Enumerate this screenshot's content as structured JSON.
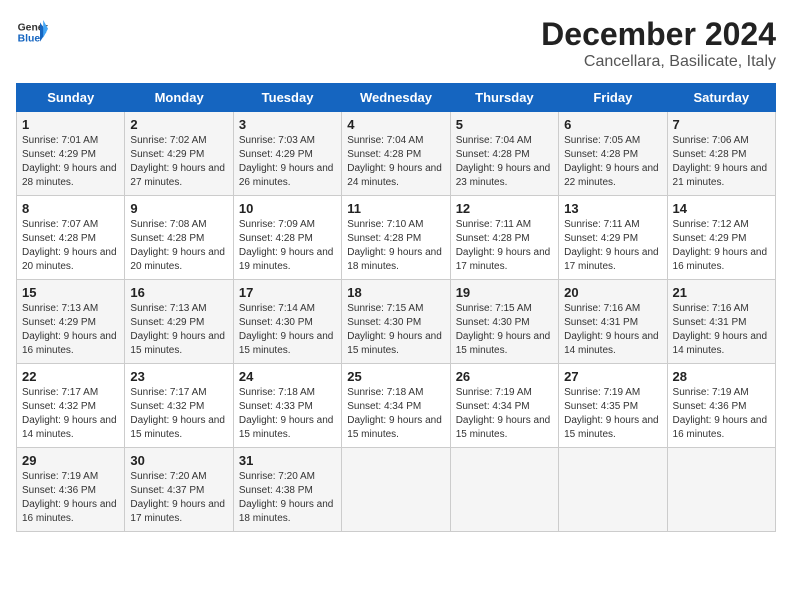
{
  "header": {
    "logo_line1": "General",
    "logo_line2": "Blue",
    "month": "December 2024",
    "location": "Cancellara, Basilicate, Italy"
  },
  "weekdays": [
    "Sunday",
    "Monday",
    "Tuesday",
    "Wednesday",
    "Thursday",
    "Friday",
    "Saturday"
  ],
  "weeks": [
    [
      {
        "day": "1",
        "sunrise": "Sunrise: 7:01 AM",
        "sunset": "Sunset: 4:29 PM",
        "daylight": "Daylight: 9 hours and 28 minutes."
      },
      {
        "day": "2",
        "sunrise": "Sunrise: 7:02 AM",
        "sunset": "Sunset: 4:29 PM",
        "daylight": "Daylight: 9 hours and 27 minutes."
      },
      {
        "day": "3",
        "sunrise": "Sunrise: 7:03 AM",
        "sunset": "Sunset: 4:29 PM",
        "daylight": "Daylight: 9 hours and 26 minutes."
      },
      {
        "day": "4",
        "sunrise": "Sunrise: 7:04 AM",
        "sunset": "Sunset: 4:28 PM",
        "daylight": "Daylight: 9 hours and 24 minutes."
      },
      {
        "day": "5",
        "sunrise": "Sunrise: 7:04 AM",
        "sunset": "Sunset: 4:28 PM",
        "daylight": "Daylight: 9 hours and 23 minutes."
      },
      {
        "day": "6",
        "sunrise": "Sunrise: 7:05 AM",
        "sunset": "Sunset: 4:28 PM",
        "daylight": "Daylight: 9 hours and 22 minutes."
      },
      {
        "day": "7",
        "sunrise": "Sunrise: 7:06 AM",
        "sunset": "Sunset: 4:28 PM",
        "daylight": "Daylight: 9 hours and 21 minutes."
      }
    ],
    [
      {
        "day": "8",
        "sunrise": "Sunrise: 7:07 AM",
        "sunset": "Sunset: 4:28 PM",
        "daylight": "Daylight: 9 hours and 20 minutes."
      },
      {
        "day": "9",
        "sunrise": "Sunrise: 7:08 AM",
        "sunset": "Sunset: 4:28 PM",
        "daylight": "Daylight: 9 hours and 20 minutes."
      },
      {
        "day": "10",
        "sunrise": "Sunrise: 7:09 AM",
        "sunset": "Sunset: 4:28 PM",
        "daylight": "Daylight: 9 hours and 19 minutes."
      },
      {
        "day": "11",
        "sunrise": "Sunrise: 7:10 AM",
        "sunset": "Sunset: 4:28 PM",
        "daylight": "Daylight: 9 hours and 18 minutes."
      },
      {
        "day": "12",
        "sunrise": "Sunrise: 7:11 AM",
        "sunset": "Sunset: 4:28 PM",
        "daylight": "Daylight: 9 hours and 17 minutes."
      },
      {
        "day": "13",
        "sunrise": "Sunrise: 7:11 AM",
        "sunset": "Sunset: 4:29 PM",
        "daylight": "Daylight: 9 hours and 17 minutes."
      },
      {
        "day": "14",
        "sunrise": "Sunrise: 7:12 AM",
        "sunset": "Sunset: 4:29 PM",
        "daylight": "Daylight: 9 hours and 16 minutes."
      }
    ],
    [
      {
        "day": "15",
        "sunrise": "Sunrise: 7:13 AM",
        "sunset": "Sunset: 4:29 PM",
        "daylight": "Daylight: 9 hours and 16 minutes."
      },
      {
        "day": "16",
        "sunrise": "Sunrise: 7:13 AM",
        "sunset": "Sunset: 4:29 PM",
        "daylight": "Daylight: 9 hours and 15 minutes."
      },
      {
        "day": "17",
        "sunrise": "Sunrise: 7:14 AM",
        "sunset": "Sunset: 4:30 PM",
        "daylight": "Daylight: 9 hours and 15 minutes."
      },
      {
        "day": "18",
        "sunrise": "Sunrise: 7:15 AM",
        "sunset": "Sunset: 4:30 PM",
        "daylight": "Daylight: 9 hours and 15 minutes."
      },
      {
        "day": "19",
        "sunrise": "Sunrise: 7:15 AM",
        "sunset": "Sunset: 4:30 PM",
        "daylight": "Daylight: 9 hours and 15 minutes."
      },
      {
        "day": "20",
        "sunrise": "Sunrise: 7:16 AM",
        "sunset": "Sunset: 4:31 PM",
        "daylight": "Daylight: 9 hours and 14 minutes."
      },
      {
        "day": "21",
        "sunrise": "Sunrise: 7:16 AM",
        "sunset": "Sunset: 4:31 PM",
        "daylight": "Daylight: 9 hours and 14 minutes."
      }
    ],
    [
      {
        "day": "22",
        "sunrise": "Sunrise: 7:17 AM",
        "sunset": "Sunset: 4:32 PM",
        "daylight": "Daylight: 9 hours and 14 minutes."
      },
      {
        "day": "23",
        "sunrise": "Sunrise: 7:17 AM",
        "sunset": "Sunset: 4:32 PM",
        "daylight": "Daylight: 9 hours and 15 minutes."
      },
      {
        "day": "24",
        "sunrise": "Sunrise: 7:18 AM",
        "sunset": "Sunset: 4:33 PM",
        "daylight": "Daylight: 9 hours and 15 minutes."
      },
      {
        "day": "25",
        "sunrise": "Sunrise: 7:18 AM",
        "sunset": "Sunset: 4:34 PM",
        "daylight": "Daylight: 9 hours and 15 minutes."
      },
      {
        "day": "26",
        "sunrise": "Sunrise: 7:19 AM",
        "sunset": "Sunset: 4:34 PM",
        "daylight": "Daylight: 9 hours and 15 minutes."
      },
      {
        "day": "27",
        "sunrise": "Sunrise: 7:19 AM",
        "sunset": "Sunset: 4:35 PM",
        "daylight": "Daylight: 9 hours and 15 minutes."
      },
      {
        "day": "28",
        "sunrise": "Sunrise: 7:19 AM",
        "sunset": "Sunset: 4:36 PM",
        "daylight": "Daylight: 9 hours and 16 minutes."
      }
    ],
    [
      {
        "day": "29",
        "sunrise": "Sunrise: 7:19 AM",
        "sunset": "Sunset: 4:36 PM",
        "daylight": "Daylight: 9 hours and 16 minutes."
      },
      {
        "day": "30",
        "sunrise": "Sunrise: 7:20 AM",
        "sunset": "Sunset: 4:37 PM",
        "daylight": "Daylight: 9 hours and 17 minutes."
      },
      {
        "day": "31",
        "sunrise": "Sunrise: 7:20 AM",
        "sunset": "Sunset: 4:38 PM",
        "daylight": "Daylight: 9 hours and 18 minutes."
      },
      null,
      null,
      null,
      null
    ]
  ]
}
